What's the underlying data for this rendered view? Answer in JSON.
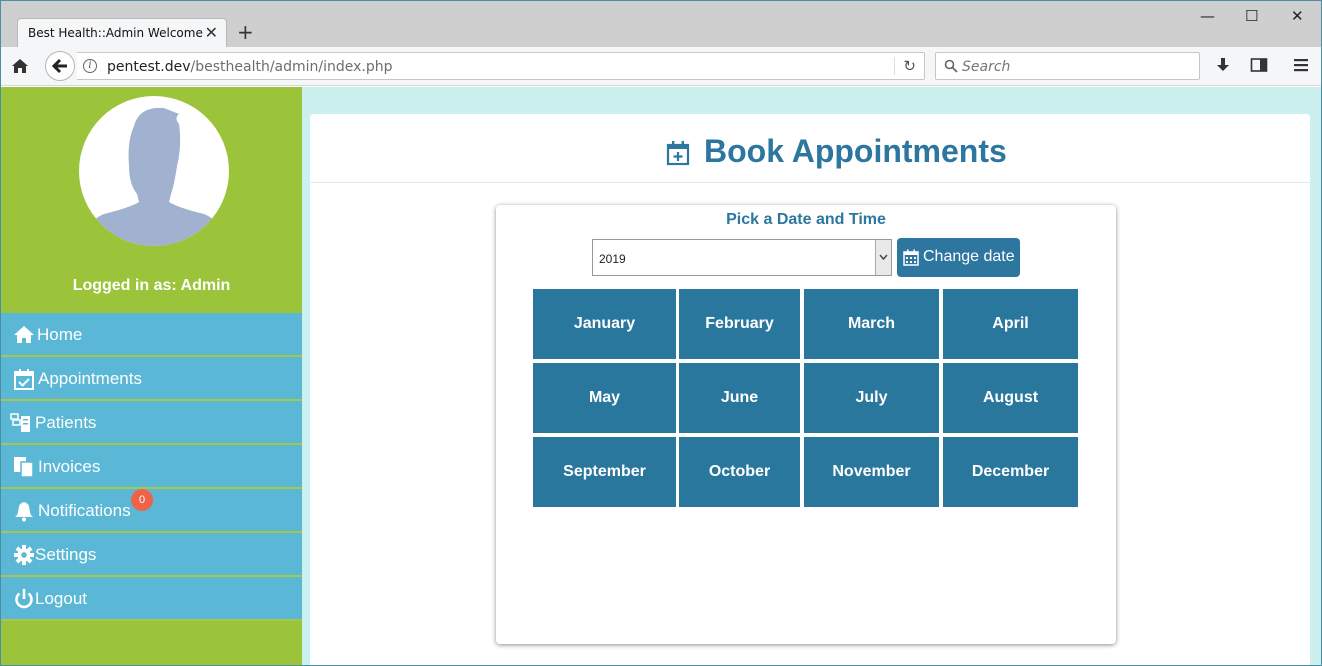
{
  "browser": {
    "tab_title": "Best Health::Admin Welcome",
    "tab_close": "✕",
    "new_tab": "+",
    "url_host": "pentest.dev",
    "url_path": "/besthealth/admin/index.php",
    "search_placeholder": "Search",
    "window_controls": [
      "—",
      "☐",
      "✕"
    ]
  },
  "sidebar": {
    "logged_in": "Logged in as: Admin",
    "items": [
      {
        "label": "Home",
        "icon": "home-icon"
      },
      {
        "label": "Appointments",
        "icon": "calendar-check-icon"
      },
      {
        "label": "Patients",
        "icon": "patients-icon"
      },
      {
        "label": "Invoices",
        "icon": "invoices-icon"
      },
      {
        "label": "Notifications",
        "icon": "bell-icon",
        "badge": "0"
      },
      {
        "label": "Settings",
        "icon": "gear-icon"
      },
      {
        "label": "Logout",
        "icon": "power-icon"
      }
    ]
  },
  "main": {
    "title": "Book Appointments",
    "picker": {
      "title": "Pick a Date and Time",
      "year": "2019",
      "change_label": "Change date"
    },
    "months": [
      "January",
      "February",
      "March",
      "April",
      "May",
      "June",
      "July",
      "August",
      "September",
      "October",
      "November",
      "December"
    ]
  },
  "colors": {
    "sidebar_green": "#9cc43a",
    "menu_blue": "#5ab7d5",
    "accent_blue": "#2c76a0",
    "month_tile": "#2a779e",
    "badge_red": "#f0614a"
  }
}
